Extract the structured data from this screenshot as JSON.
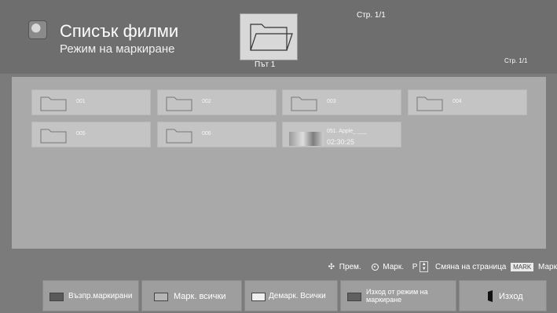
{
  "header": {
    "title": "Списък филми",
    "subtitle": "Режим на маркиране",
    "page_top": "Стр. 1/1",
    "path_label": "Път 1",
    "page_right": "Стр. 1/1"
  },
  "items": [
    {
      "label": "001",
      "type": "folder"
    },
    {
      "label": "002",
      "type": "folder"
    },
    {
      "label": "003",
      "type": "folder"
    },
    {
      "label": "004",
      "type": "folder"
    },
    {
      "label": "005",
      "type": "folder"
    },
    {
      "label": "006",
      "type": "folder"
    },
    {
      "label": "051. Apple_ ___",
      "duration": "02:30:25",
      "type": "video"
    }
  ],
  "hints": {
    "move": "Прем.",
    "mark": "Марк.",
    "page_p": "P",
    "page_change": "Смяна на страница",
    "mark_key": "MARK",
    "mark_key_label": "Марк"
  },
  "buttons": {
    "red": "Възпр.маркирани",
    "green": "Марк. всички",
    "yellow": "Демарк. Всички",
    "blue": "Изход от режим на маркиране",
    "exit": "Изход"
  },
  "colors": {
    "red": "#5a5a5a",
    "green": "#b5b5b5",
    "yellow": "#efefef",
    "blue": "#606060"
  }
}
